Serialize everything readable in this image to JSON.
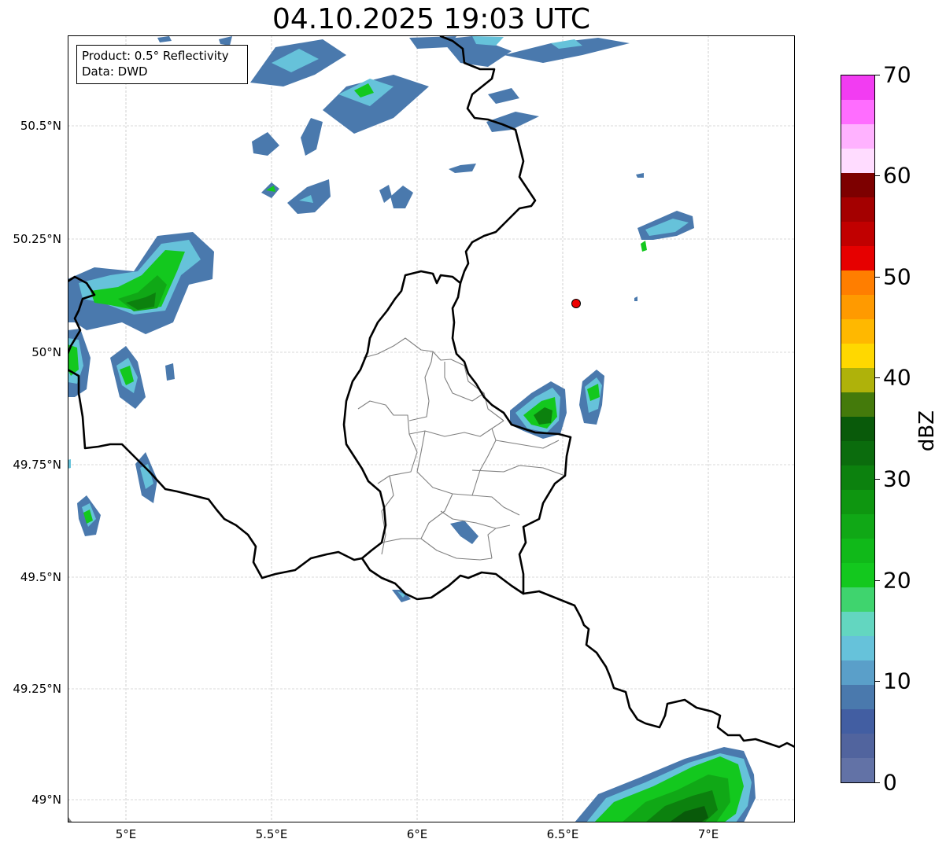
{
  "title": "04.10.2025 19:03 UTC",
  "info": {
    "product": "Product: 0.5° Reflectivity",
    "source": "Data: DWD"
  },
  "map": {
    "lon_range": [
      4.8,
      7.3
    ],
    "lat_range": [
      48.95,
      50.7
    ],
    "lat_ticks": [
      "50.5°N",
      "50.25°N",
      "50°N",
      "49.75°N",
      "49.5°N",
      "49.25°N",
      "49°N"
    ],
    "lon_ticks": [
      "5°E",
      "5.5°E",
      "6°E",
      "6.5°E",
      "7°E"
    ],
    "grid": true,
    "marker": {
      "lon": 6.55,
      "lat": 50.11,
      "color": "#ee0000",
      "name": "radar-site-marker"
    }
  },
  "colorbar": {
    "unit": "dBZ",
    "min": 0,
    "max": 70,
    "tick_labels": [
      "0",
      "10",
      "20",
      "30",
      "40",
      "50",
      "60",
      "70"
    ],
    "colors": [
      "#6272a6",
      "#51649e",
      "#425ea2",
      "#4a79ad",
      "#5a9fc9",
      "#66c2da",
      "#63d6c0",
      "#3fd46e",
      "#13c81e",
      "#10b919",
      "#10a816",
      "#0e9610",
      "#0c810e",
      "#0b6c0d",
      "#095a0a",
      "#447a0b",
      "#afb20a",
      "#ffd800",
      "#ffb800",
      "#ff9a00",
      "#ff7e00",
      "#e60000",
      "#c10000",
      "#a40000",
      "#7d0000",
      "#ffdcff",
      "#ffb2ff",
      "#ff6dff",
      "#f23cf2"
    ]
  }
}
